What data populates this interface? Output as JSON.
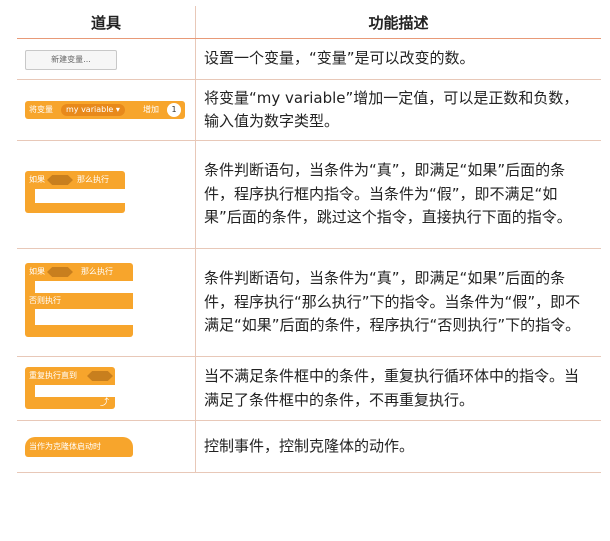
{
  "header": {
    "col1": "道具",
    "col2": "功能描述"
  },
  "rows": [
    {
      "tool": {
        "label": "新建变量..."
      },
      "desc": "设置一个变量，“变量”是可以改变的数。"
    },
    {
      "tool": {
        "prefix": "将变量",
        "variable": "my variable ▾",
        "action": "增加",
        "value": "1"
      },
      "desc": "将变量“my variable”增加一定值，可以是正数和负数，输入值为数字类型。"
    },
    {
      "tool": {
        "if_label": "如果",
        "then_label": "那么执行"
      },
      "desc": "条件判断语句，当条件为“真”，即满足“如果”后面的条件，程序执行框内指令。当条件为“假”，即不满足“如果”后面的条件，跳过这个指令，直接执行下面的指令。"
    },
    {
      "tool": {
        "if_label": "如果",
        "then_label": "那么执行",
        "else_label": "否则执行"
      },
      "desc": "条件判断语句，当条件为“真”，即满足“如果”后面的条件，程序执行“那么执行”下的指令。当条件为“假”，即不满足“如果”后面的条件，程序执行“否则执行”下的指令。"
    },
    {
      "tool": {
        "label": "重复执行直到",
        "arrow": "⤴"
      },
      "desc": "当不满足条件框中的条件，重复执行循环体中的指令。当满足了条件框中的条件，不再重复执行。"
    },
    {
      "tool": {
        "label": "当作为克隆体启动时"
      },
      "desc": "控制事件，控制克隆体的动作。"
    }
  ],
  "colors": {
    "block": "#f7a52c",
    "block_dark": "#e8891a",
    "header_border": "#e89a78",
    "row_border": "#e8c8b8"
  }
}
